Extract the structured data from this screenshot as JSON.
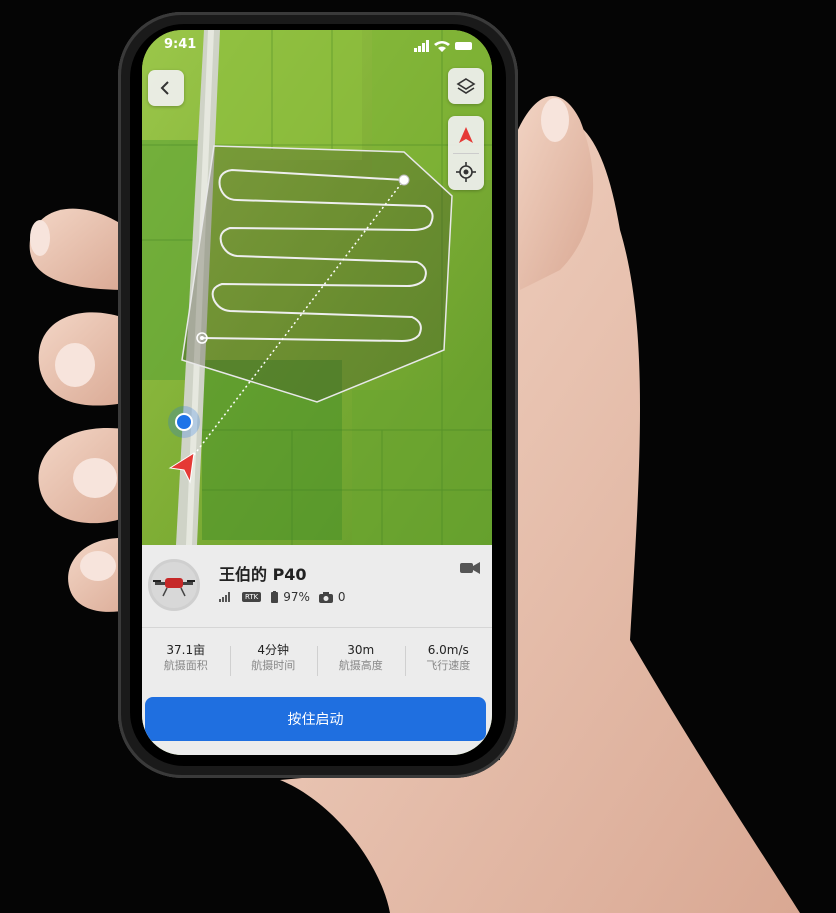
{
  "status_bar": {
    "time": "9:41"
  },
  "map": {
    "back_icon": "chevron-left-icon",
    "layers_icon": "layers-icon",
    "compass_icon": "north-arrow-icon",
    "locate_icon": "crosshair-icon"
  },
  "drone": {
    "name": "王伯的 P40",
    "rtk_label": "RTK",
    "battery": "97%",
    "photos": "0"
  },
  "metrics": [
    {
      "value": "37.1亩",
      "label": "航摄面积"
    },
    {
      "value": "4分钟",
      "label": "航摄时间"
    },
    {
      "value": "30m",
      "label": "航摄高度"
    },
    {
      "value": "6.0m/s",
      "label": "飞行速度"
    }
  ],
  "actions": {
    "start_label": "按住启动"
  },
  "colors": {
    "accent": "#1f6fe0",
    "marker_red": "#e53935",
    "drone_position": "#1e73e8"
  }
}
